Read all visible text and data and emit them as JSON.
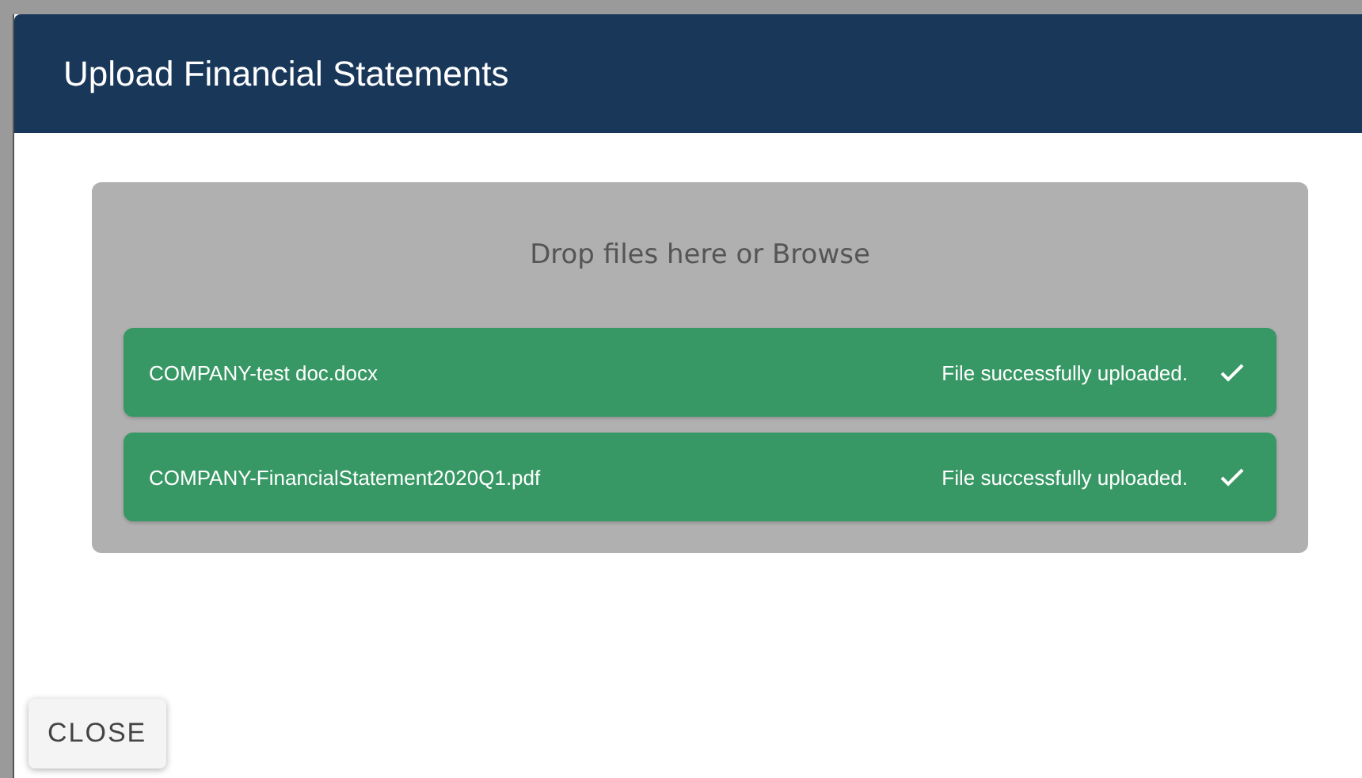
{
  "dialog": {
    "title": "Upload Financial Statements"
  },
  "dropzone": {
    "prompt": "Drop files here or Browse"
  },
  "files": [
    {
      "name": "COMPANY-test doc.docx",
      "uploaded": true,
      "message": "File successfully uploaded."
    },
    {
      "name": "COMPANY-FinancialStatement2020Q1.pdf",
      "uploaded": true,
      "message": "File successfully uploaded."
    }
  ],
  "buttons": [
    "CLOSE"
  ]
}
